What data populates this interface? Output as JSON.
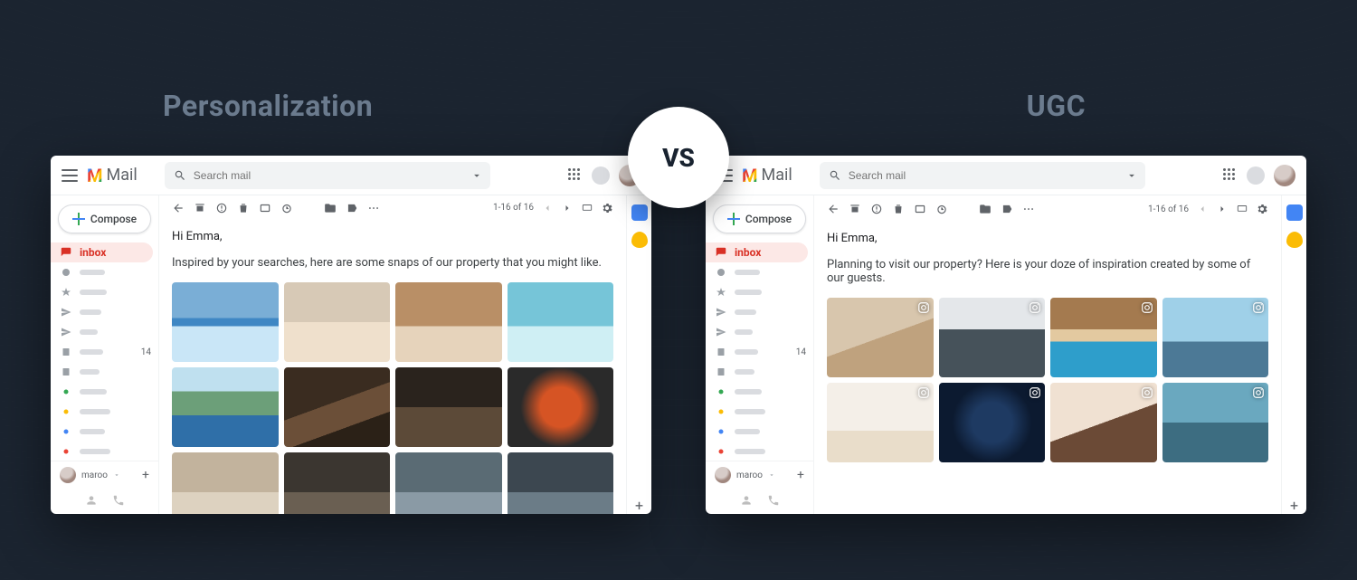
{
  "comparison": {
    "left_title": "Personalization",
    "right_title": "UGC",
    "vs": "VS"
  },
  "mail_app": {
    "product": "Mail",
    "logo_initial": "M",
    "search_placeholder": "Search mail",
    "compose_label": "Compose",
    "inbox_label": "inbox",
    "inbox_count": "14",
    "hangouts_user": "maroo",
    "pagination": "1-16 of 16"
  },
  "sidebar": {
    "items": [
      {
        "icon": "inbox",
        "active": true
      },
      {
        "icon": "clock",
        "color": "#5f6368",
        "stub_w": 28
      },
      {
        "icon": "star",
        "color": "#5f6368",
        "stub_w": 30
      },
      {
        "icon": "send",
        "color": "#5f6368",
        "stub_w": 24
      },
      {
        "icon": "send",
        "color": "#5f6368",
        "stub_w": 20
      },
      {
        "icon": "file",
        "color": "#5f6368",
        "stub_w": 26
      },
      {
        "icon": "file",
        "color": "#5f6368",
        "stub_w": 22
      },
      {
        "icon": "tag",
        "color": "#34a853",
        "stub_w": 30
      },
      {
        "icon": "tag",
        "color": "#fbbc05",
        "stub_w": 34
      },
      {
        "icon": "tag",
        "color": "#4285f4",
        "stub_w": 28
      },
      {
        "icon": "tag",
        "color": "#ea4335",
        "stub_w": 34
      },
      {
        "icon": "chev",
        "color": "#5f6368",
        "stub_w": 24
      }
    ]
  },
  "emails": {
    "left": {
      "greeting": "Hi Emma,",
      "body": "Inspired by your searches, here are some snaps of our property that you might like.",
      "image_count": 12,
      "has_ig_badge": false
    },
    "right": {
      "greeting": "Hi Emma,",
      "body": "Planning to visit our property? Here is your doze of inspiration created by some of our guests.",
      "image_count": 8,
      "has_ig_badge": true
    }
  }
}
